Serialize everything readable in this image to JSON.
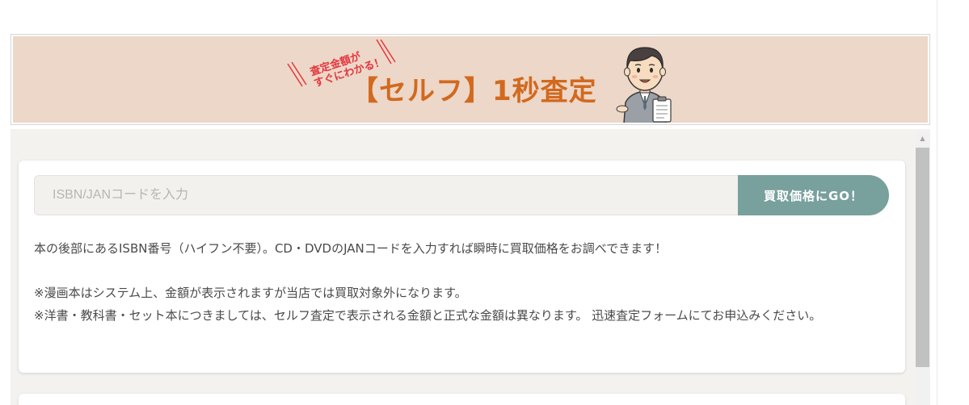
{
  "banner": {
    "tag_line1": "査定金額が",
    "tag_line2": "すぐにわかる！",
    "title": "【セルフ】1秒査定",
    "colors": {
      "background": "#ecd7c8",
      "title": "#d2691e",
      "tag": "#e5363f"
    },
    "mascot_icon": "businessman-with-clipboard-icon"
  },
  "search": {
    "placeholder": "ISBN/JANコードを入力",
    "value": "",
    "button_label": "買取価格にGO！",
    "button_color": "#78a09d"
  },
  "description": {
    "line1": "本の後部にあるISBN番号（ハイフン不要）。CD・DVDのJANコードを入力すれば瞬時に買取価格をお調べできます！",
    "note1": "※漫画本はシステム上、金額が表示されますが当店では買取対象外になります。",
    "note2": "※洋書・教科書・セット本につきましては、セルフ査定で表示される金額と正式な金額は異なります。 迅速査定フォームにてお申込みください。"
  }
}
